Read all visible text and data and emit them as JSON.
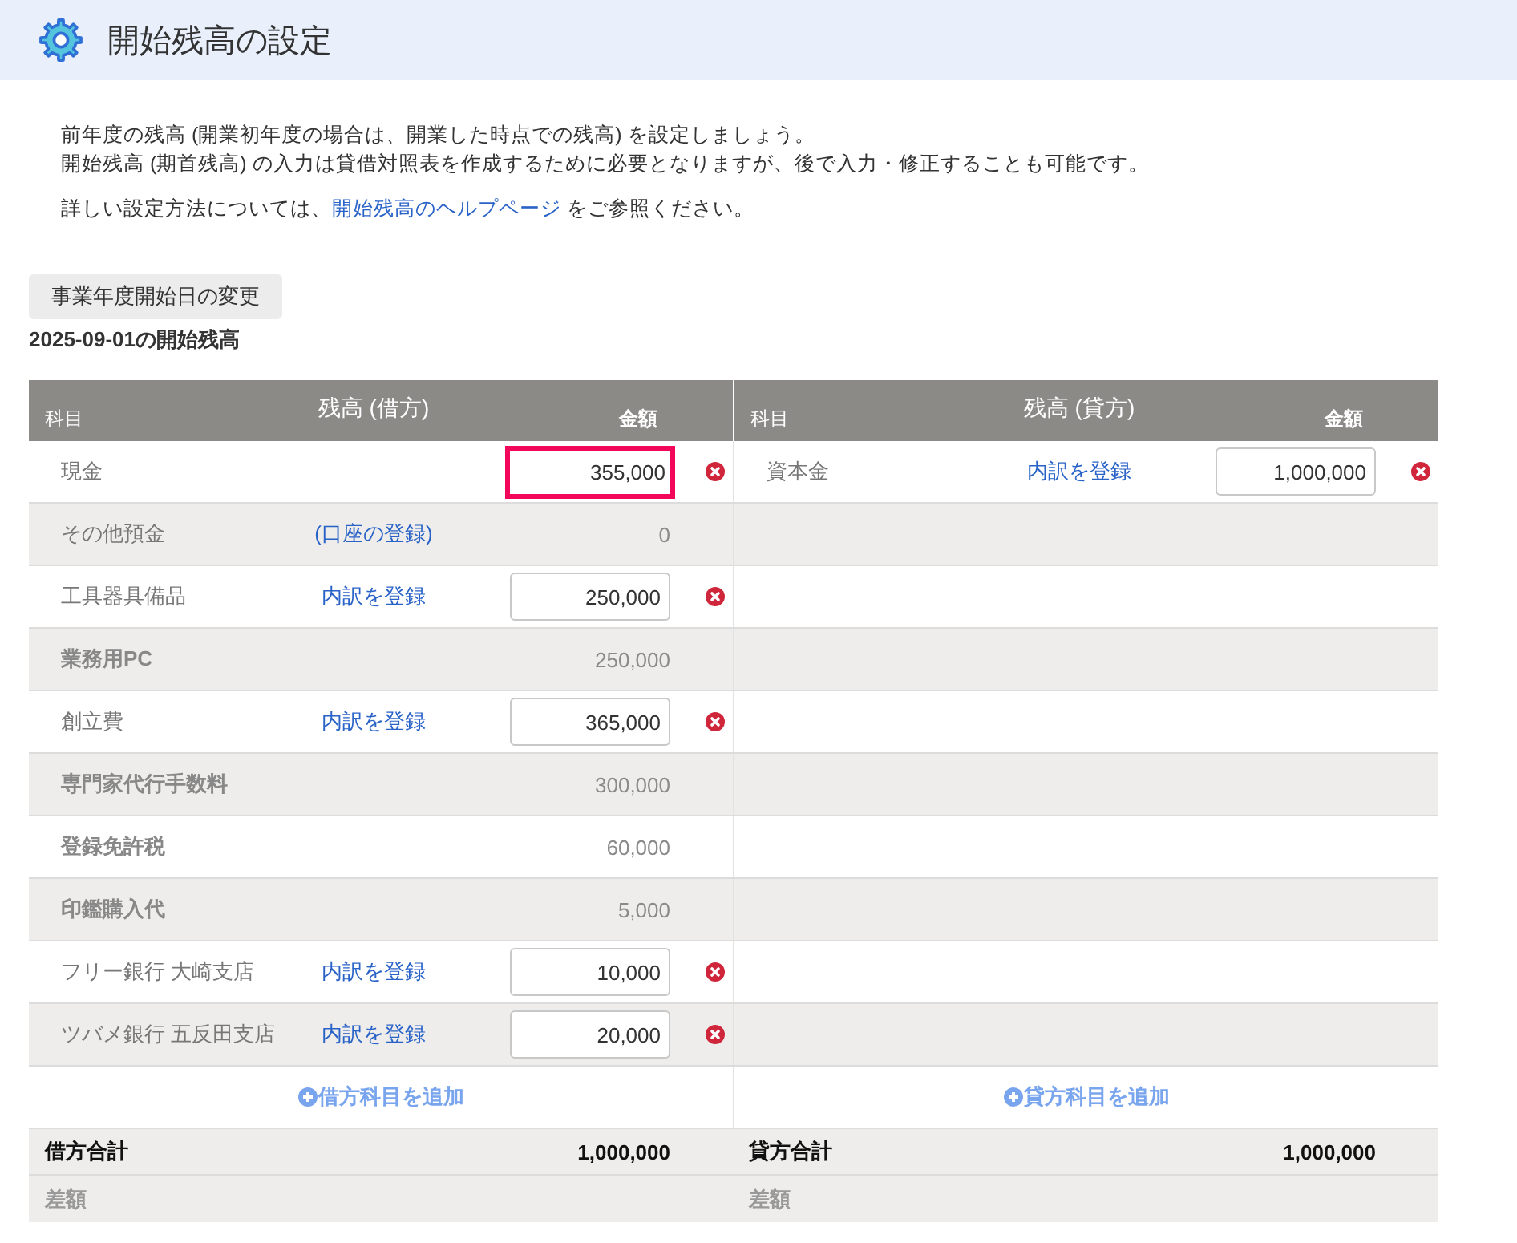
{
  "header": {
    "title": "開始残高の設定"
  },
  "intro": {
    "lines": [
      "前年度の残高 (開業初年度の場合は、開業した時点での残高) を設定しましょう。",
      "開始残高 (期首残高) の入力は貸借対照表を作成するために必要となりますが、後で入力・修正することも可能です。"
    ],
    "help": {
      "before": "詳しい設定方法については、",
      "link": "開始残高のヘルプページ",
      "after": " をご参照ください。"
    }
  },
  "change_button": "事業年度開始日の変更",
  "balance_title": "2025-09-01の開始残高",
  "debit": {
    "account_header": "科目",
    "heading": "残高 (借方)",
    "amount_header": "金額",
    "rows": [
      {
        "kind": "input",
        "name": "現金",
        "amount": "355,000",
        "highlighted": true
      },
      {
        "kind": "static",
        "name": "その他預金",
        "link": "(口座の登録)",
        "amount": "0"
      },
      {
        "kind": "input",
        "name": "工具器具備品",
        "link": "内訳を登録",
        "amount": "250,000",
        "highlighted": false,
        "children": [
          {
            "name": "業務用PC",
            "amount": "250,000"
          }
        ]
      },
      {
        "kind": "input",
        "name": "創立費",
        "link": "内訳を登録",
        "amount": "365,000",
        "highlighted": false,
        "children": [
          {
            "name": "専門家代行手数料",
            "amount": "300,000"
          },
          {
            "name": "登録免許税",
            "amount": "60,000"
          },
          {
            "name": "印鑑購入代",
            "amount": "5,000"
          }
        ]
      },
      {
        "kind": "input",
        "name": "フリー銀行 大崎支店",
        "link": "内訳を登録",
        "amount": "10,000",
        "highlighted": false
      },
      {
        "kind": "input",
        "name": "ツバメ銀行 五反田支店",
        "link": "内訳を登録",
        "amount": "20,000",
        "highlighted": false
      }
    ],
    "add": "借方科目を追加",
    "total_label": "借方合計",
    "total": "1,000,000",
    "diff_label": "差額"
  },
  "credit": {
    "account_header": "科目",
    "heading": "残高 (貸方)",
    "amount_header": "金額",
    "rows": [
      {
        "kind": "input",
        "name": "資本金",
        "link": "内訳を登録",
        "amount": "1,000,000",
        "highlighted": false
      }
    ],
    "add": "貸方科目を追加",
    "total_label": "貸方合計",
    "total": "1,000,000",
    "diff_label": "差額"
  }
}
